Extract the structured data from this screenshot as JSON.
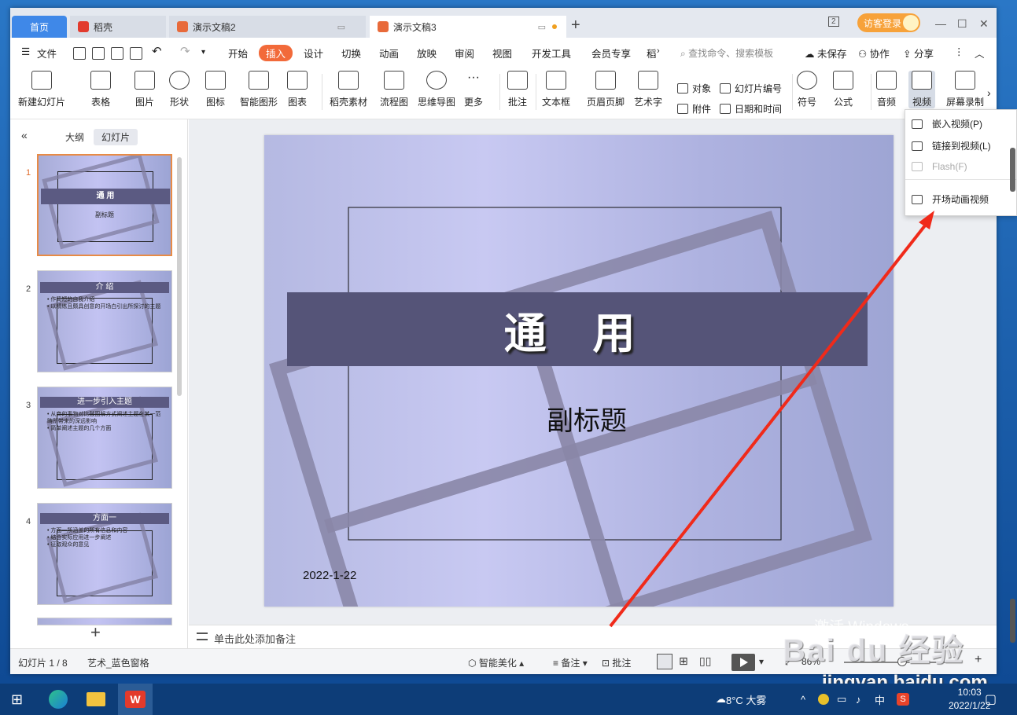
{
  "tabs": {
    "home": "首页",
    "t1": "稻壳",
    "t2": "演示文稿2",
    "t3": "演示文稿3",
    "new": "+"
  },
  "window": {
    "login": "访客登录",
    "pages_badge": "2"
  },
  "menu": {
    "file": "文件",
    "items": [
      "开始",
      "插入",
      "设计",
      "切换",
      "动画",
      "放映",
      "审阅",
      "视图",
      "开发工具",
      "会员专享",
      "稻"
    ],
    "active_index": 1,
    "search": "查找命令、搜索模板",
    "unsaved": "未保存",
    "collab": "协作",
    "share": "分享"
  },
  "ribbon": {
    "new_slide": "新建幻灯片",
    "table": "表格",
    "picture": "图片",
    "shape": "形状",
    "icon": "图标",
    "smart": "智能图形",
    "chart": "图表",
    "daoke": "稻壳素材",
    "flow": "流程图",
    "mind": "思维导图",
    "more": "更多",
    "comment": "批注",
    "textbox": "文本框",
    "header_footer": "页眉页脚",
    "wordart": "艺术字",
    "object": "对象",
    "attach": "附件",
    "slide_num": "幻灯片编号",
    "datetime": "日期和时间",
    "symbol": "符号",
    "formula": "公式",
    "audio": "音频",
    "video": "视频",
    "screen_rec": "屏幕录制"
  },
  "video_menu": {
    "embed": "嵌入视频(P)",
    "link": "链接到视频(L)",
    "flash": "Flash(F)",
    "opening": "开场动画视频"
  },
  "panel": {
    "outline": "大纲",
    "slides": "幻灯片"
  },
  "thumbnails": [
    {
      "num": "1",
      "title": "通 用",
      "sub": "副标题",
      "lines": []
    },
    {
      "num": "2",
      "title": "介 绍",
      "lines": [
        "• 作简短的自我介绍",
        "• 以精练且颇具创意的开场白引出所探讨的主题"
      ]
    },
    {
      "num": "3",
      "title": "进一步引入主题",
      "lines": [
        "• 从商的事物对比鼓图解方式阐述主题在某一范畴所带来的深远影响",
        "• 简单阐述主题的几个方面"
      ]
    },
    {
      "num": "4",
      "title": "方面一",
      "lines": [
        "• 方面一所涵盖的所有信息和内容",
        "• 结合实际应用进一步阐述",
        "• 征取观众的意见"
      ]
    }
  ],
  "slide": {
    "title": "通 用",
    "subtitle": "副标题",
    "date": "2022-1-22"
  },
  "notes": {
    "placeholder": "单击此处添加备注"
  },
  "status": {
    "slide_count": "幻灯片 1 / 8",
    "theme": "艺术_蓝色窗格",
    "beautify": "智能美化",
    "notes": "备注",
    "comment": "批注",
    "zoom": "86%"
  },
  "taskbar": {
    "weather": "8°C 大雾",
    "ime": "中",
    "time": "10:03",
    "date": "2022/1/22"
  },
  "watermark": {
    "activate": "激活 Windows",
    "site": "jingyan.baidu.com",
    "logo": "Bai du 经验"
  },
  "colors": {
    "accent": "#f26a3a",
    "title_bar": "#555478",
    "home_tab": "#3f88e8"
  }
}
